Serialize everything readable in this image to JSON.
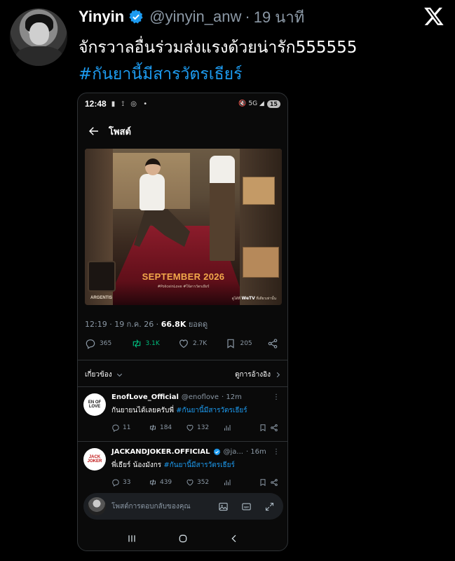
{
  "tweet": {
    "display_name": "Yinyin",
    "handle": "@yinyin_anw",
    "separator": "·",
    "time": "19 นาที",
    "text_line1": "จักรวาลอื่นร่วมส่งแรงด้วยน่ารัก555555",
    "hashtag": "#กันยานี้มีสารวัตรเธียร์"
  },
  "icons": {
    "verified": "verified-badge-icon",
    "x_logo": "x-logo-icon"
  },
  "colors": {
    "background": "#000000",
    "link": "#1d9bf0",
    "retweet_green": "#00ba7c",
    "muted": "#8b98a5",
    "poster_title": "#f2a84b"
  },
  "phone": {
    "status_time": "12:48",
    "status_left_icons": "▮ ⟟ ◎ •",
    "status_right_icons": "🔇 5G ◢",
    "battery": "15",
    "header_title": "โพสต์",
    "poster": {
      "title": "SEPTEMBER 2026",
      "tags": "#PoliceinLove #ใจ้สารวัตรเธียร์",
      "brand": "ARGENTIS",
      "wetv_prefix": "ดูได้ที่",
      "wetv": "WeTV",
      "wetv_suffix": "ที่เดียวเท่านั้น"
    },
    "meta": {
      "time_date": "12:19 · 19 ก.ค. 26 · ",
      "views": "66.8K",
      "views_label": " ยอดดู"
    },
    "actions": {
      "replies": "365",
      "retweets": "3.1K",
      "likes": "2.7K",
      "bookmarks": "205"
    },
    "related": {
      "label": "เกี่ยวข้อง",
      "quotes": "ดูการอ้างอิง"
    },
    "replies": [
      {
        "name": "EnofLove_Official",
        "handle": "@enoflove",
        "time": "· 12m",
        "avatar_text": "EN OF LOVE",
        "text": "กันยายนได้เลยครับพี่ ",
        "hashtag": "#กันยานี้มีสารวัตรเธียร์",
        "replies": "11",
        "retweets": "184",
        "likes": "132"
      },
      {
        "name": "JACKANDJOKER.OFFICIAL",
        "handle": "@ja...",
        "time": "· 16m",
        "avatar_text": "JACK JOKER",
        "text": "พี่เธียร์ น้องมังกร ",
        "hashtag": "#กันยานี้มีสารวัตรเธียร์",
        "replies": "33",
        "retweets": "439",
        "likes": "352"
      }
    ],
    "composer_placeholder": "โพสต์การตอบกลับของคุณ"
  }
}
